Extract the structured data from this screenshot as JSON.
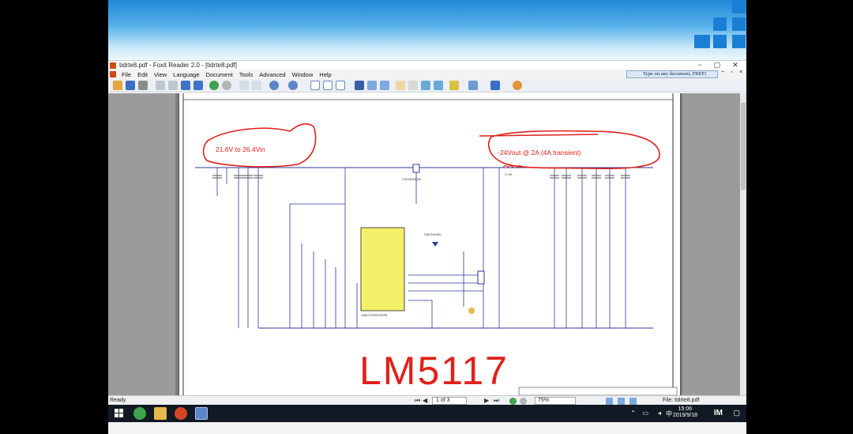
{
  "window": {
    "title": "tidrte8.pdf - Foxit Reader 2.0 - [tidrte8.pdf]",
    "controls": {
      "minimize": "−",
      "maximize": "▢",
      "close": "✕"
    }
  },
  "menubar": {
    "items": [
      "File",
      "Edit",
      "View",
      "Language",
      "Document",
      "Tools",
      "Advanced",
      "Window",
      "Help"
    ],
    "search_text": "Type on any document, FREE!"
  },
  "schematic": {
    "callout_input": "21.6V to 26.4Vin",
    "callout_output": "-24Vout @ 2A (4A transient)",
    "handwritten": "LM5117",
    "ic_label": "LM5117PMHX/NOPB",
    "mosfet_label": "CSD18543Q3A",
    "diode_label": "PMEG4005EJ",
    "inductor_label": "4.7uH"
  },
  "statusbar": {
    "ready": "Ready",
    "page": "1 of 3",
    "zoom": "75%",
    "file": "File: tidrte8.pdf"
  },
  "taskbar": {
    "time": "15:06",
    "date": "2019/9/18"
  },
  "colors": {
    "annotation_red": "#e0211a",
    "wire_blue": "#2f3a9a",
    "ic_yellow": "#f5f06a",
    "taskbar": "#121924"
  }
}
